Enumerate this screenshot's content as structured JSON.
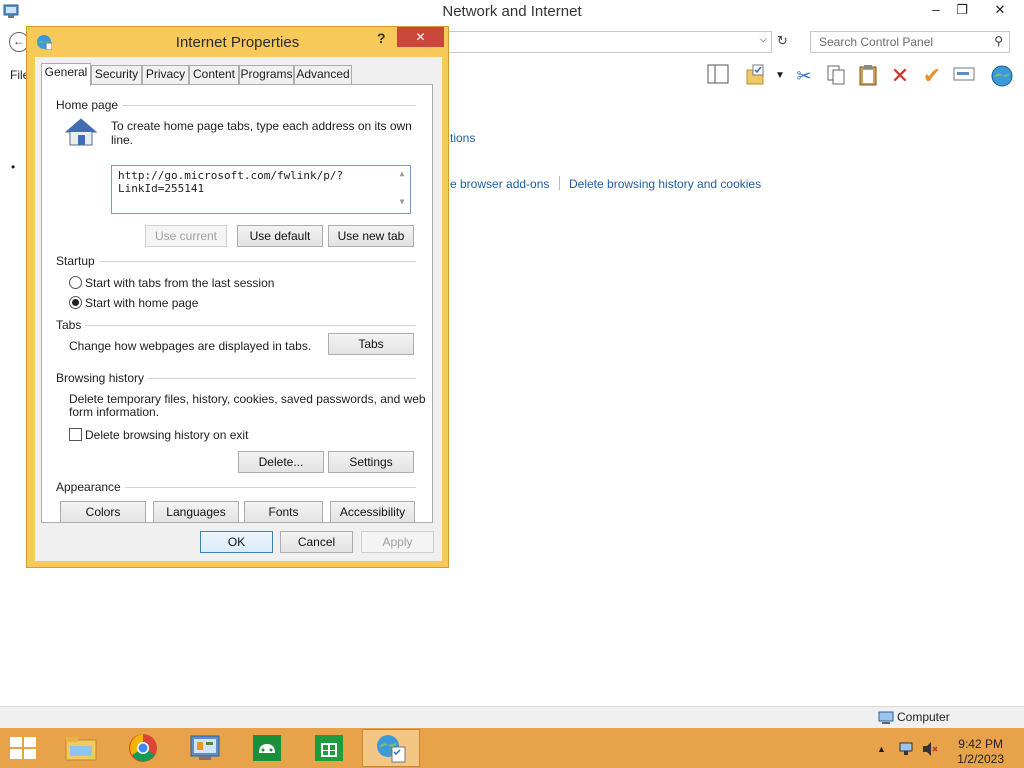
{
  "background_window": {
    "title": "Network and Internet",
    "controls": {
      "minimize": "–",
      "restore": "❐",
      "close": "✕"
    },
    "back_icon": "back-arrow",
    "search_placeholder": "Search Control Panel",
    "menu_text": "File",
    "links": {
      "link_partial_1": "tions",
      "link_partial_2": "e browser add-ons",
      "delete_history": "Delete browsing history and cookies"
    },
    "toolbar_icons": [
      "layout-icon",
      "folder-check-icon",
      "cut-icon",
      "copy-icon",
      "paste-icon",
      "delete-icon",
      "checkmark-icon",
      "rename-icon",
      "globe-icon"
    ]
  },
  "statusbar": {
    "computer_label": "Computer"
  },
  "taskbar": {
    "apps": [
      "file-explorer-icon",
      "chrome-icon",
      "control-panel-icon",
      "games-icon",
      "store-icon",
      "internet-options-icon"
    ],
    "clock_time": "9:42 PM",
    "clock_date": "1/2/2023"
  },
  "dialog": {
    "title": "Internet Properties",
    "help": "?",
    "close": "✕",
    "tabs": [
      "General",
      "Security",
      "Privacy",
      "Content",
      "Programs",
      "Advanced"
    ],
    "active_tab": "General",
    "home_page": {
      "group_label": "Home page",
      "instruction": "To create home page tabs, type each address on its own line.",
      "url_value": "http://go.microsoft.com/fwlink/p/?LinkId=255141",
      "use_current": "Use current",
      "use_default": "Use default",
      "use_new_tab": "Use new tab"
    },
    "startup": {
      "group_label": "Startup",
      "option_last_session": "Start with tabs from the last session",
      "option_home_page": "Start with home page",
      "selected": "home_page"
    },
    "tabs_section": {
      "group_label": "Tabs",
      "description": "Change how webpages are displayed in tabs.",
      "tabs_button": "Tabs"
    },
    "browsing_history": {
      "group_label": "Browsing history",
      "description_line1": "Delete temporary files, history, cookies, saved passwords, and web",
      "description_line2": "form information.",
      "delete_on_exit": "Delete browsing history on exit",
      "delete_on_exit_checked": false,
      "delete_button": "Delete...",
      "settings_button": "Settings"
    },
    "appearance": {
      "group_label": "Appearance",
      "colors": "Colors",
      "languages": "Languages",
      "fonts": "Fonts",
      "accessibility": "Accessibility"
    },
    "footer": {
      "ok": "OK",
      "cancel": "Cancel",
      "apply": "Apply"
    }
  }
}
